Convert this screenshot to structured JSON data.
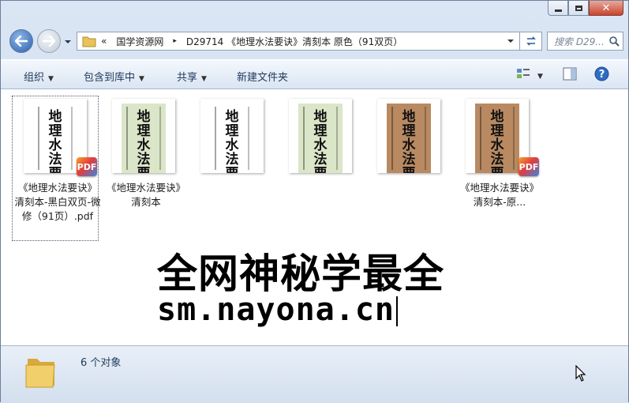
{
  "window": {
    "buttons": [
      "minimize",
      "maximize",
      "close"
    ]
  },
  "nav": {
    "back_icon": "back-arrow-icon",
    "forward_icon": "forward-arrow-icon"
  },
  "address": {
    "chevrons": "«",
    "segment1": "国学资源网",
    "separator": "▸",
    "segment2": "D29714 《地理水法要诀》清刻本 原色（91双页）"
  },
  "search": {
    "placeholder": "搜索 D29..."
  },
  "toolbar": {
    "organize": "组织",
    "include_library": "包含到库中",
    "share": "共享",
    "new_folder": "新建文件夹"
  },
  "files": [
    {
      "title_art": "地理水法要诀",
      "color": "#ffffff",
      "badge": "PDF",
      "name": "《地理水法要诀》清刻本-黑白双页-微修（91页）.pdf",
      "selected": true
    },
    {
      "title_art": "地理水法要诀",
      "color": "#dbe6c9",
      "badge": "",
      "name": "《地理水法要诀》清刻本",
      "selected": false
    },
    {
      "title_art": "地理水法要诀",
      "color": "#ffffff",
      "badge": "",
      "name": "",
      "selected": false
    },
    {
      "title_art": "地理水法要诀",
      "color": "#dbe6c9",
      "badge": "",
      "name": "",
      "selected": false
    },
    {
      "title_art": "地理水法要诀",
      "color": "#b98a62",
      "badge": "",
      "name": "",
      "selected": false
    },
    {
      "title_art": "地理水法要诀",
      "color": "#b98a62",
      "badge": "PDF",
      "name": "《地理水法要诀》清刻本-原...",
      "selected": false
    }
  ],
  "overlay": {
    "line1": "全网神秘学最全",
    "line2": "sm.nayona.cn"
  },
  "status": {
    "count": "6 个对象"
  }
}
